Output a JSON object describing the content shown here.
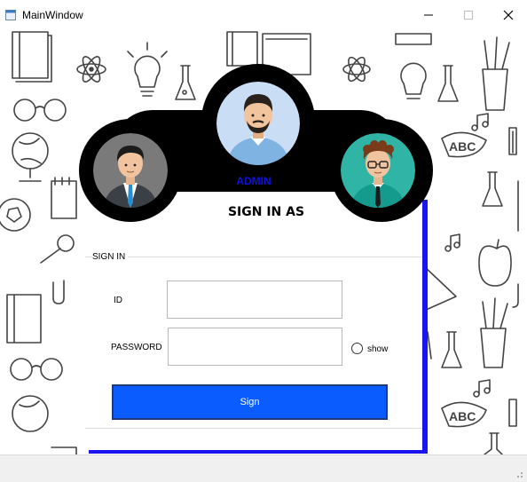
{
  "window": {
    "title": "MainWindow",
    "app_icon": "window-app-icon",
    "controls": [
      "minimize-icon",
      "maximize-icon",
      "close-icon"
    ]
  },
  "header": {
    "avatars": [
      "businessman-avatar",
      "bearded-man-avatar",
      "glasses-man-avatar"
    ],
    "admin_label": "ADMIN",
    "heading": "SIGN IN AS"
  },
  "form": {
    "group_title": "SIGN IN",
    "id_label": "ID",
    "id_value": "",
    "password_label": "PASSWORD",
    "password_value": "",
    "show_label": "show",
    "show_checked": false,
    "submit_label": "Sign"
  },
  "colors": {
    "accent_blue": "#0a5cff",
    "admin_text": "#1010e0",
    "card_shadow": "#1a14f0",
    "header_black": "#000000"
  }
}
